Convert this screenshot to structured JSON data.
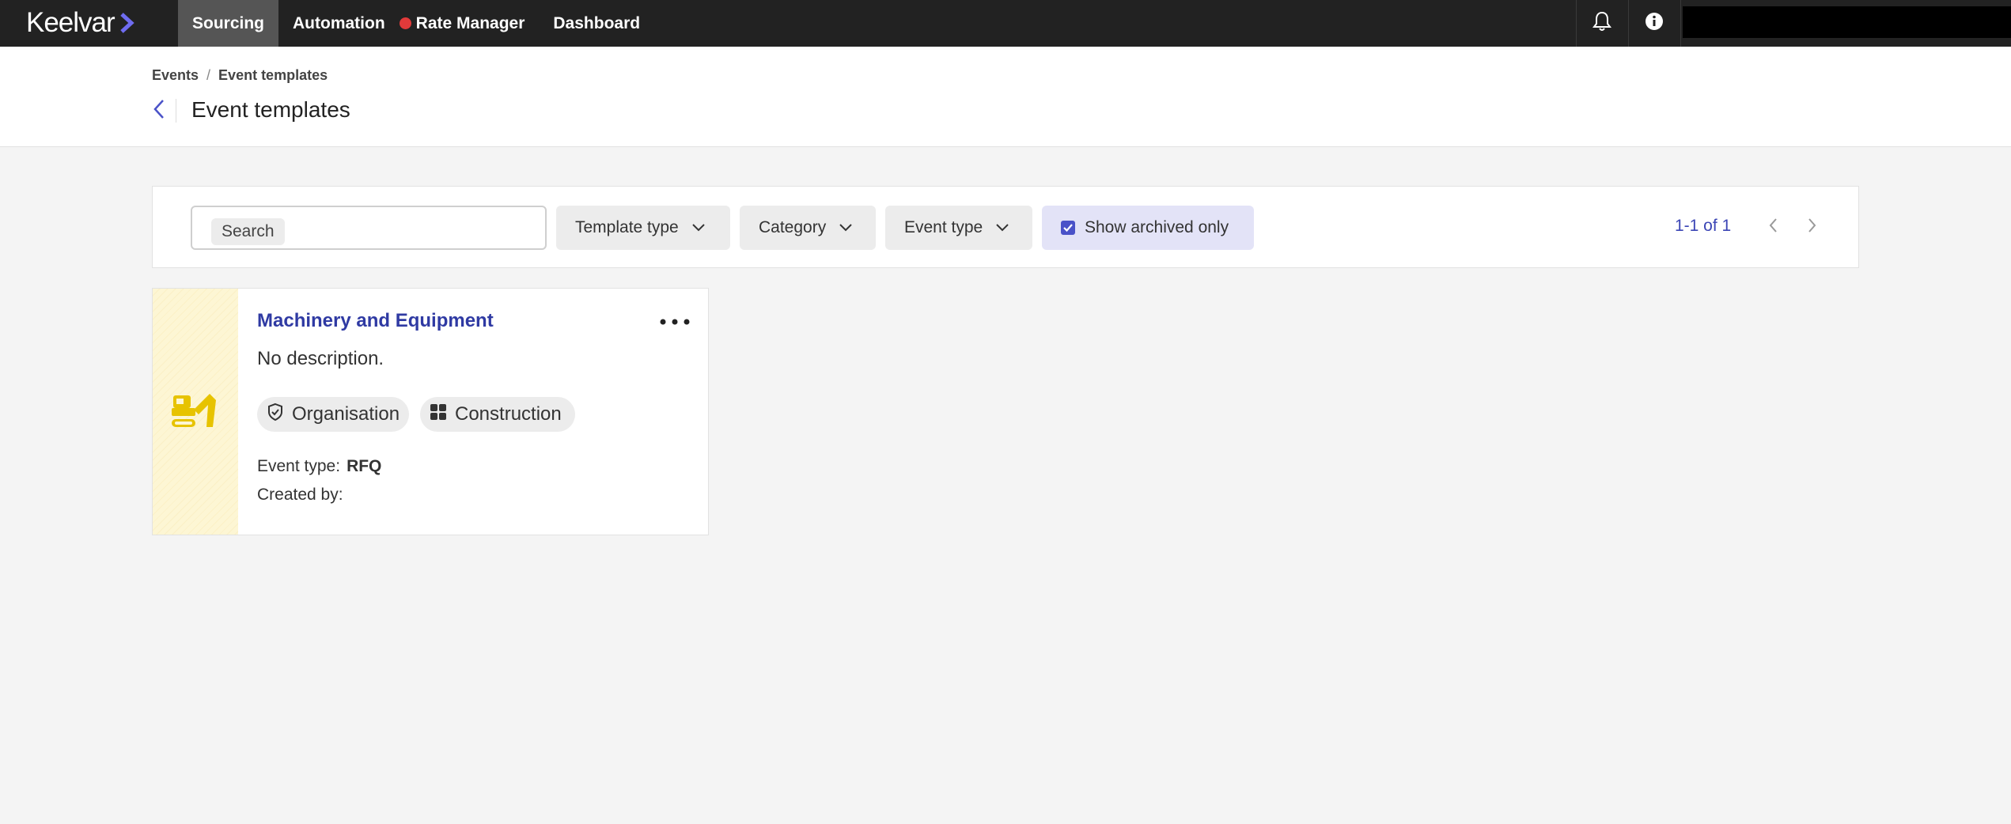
{
  "app": {
    "brand": "Keelvar",
    "accent": "#5c60e0"
  },
  "nav": {
    "items": [
      {
        "label": "Sourcing",
        "active": true
      },
      {
        "label": "Automation",
        "active": false
      },
      {
        "label": "Rate Manager",
        "active": false,
        "status_color": "#e23a3a"
      },
      {
        "label": "Dashboard",
        "active": false
      }
    ],
    "icons": [
      "bell-icon",
      "info-icon"
    ]
  },
  "header": {
    "breadcrumb": [
      "Events",
      "Event templates"
    ],
    "breadcrumb_sep": "/",
    "title": "Event templates"
  },
  "filters": {
    "search_chip": "Search",
    "template_type": "Template type",
    "category": "Category",
    "event_type": "Event type",
    "show_archived": {
      "label": "Show archived only",
      "checked": true
    },
    "pager": "1-1 of 1"
  },
  "templates": [
    {
      "title": "Machinery and Equipment",
      "description": "No description.",
      "tags": [
        {
          "label": "Organisation",
          "icon": "shield-check-icon"
        },
        {
          "label": "Construction",
          "icon": "grid-icon"
        }
      ],
      "event_type_label": "Event type:",
      "event_type_value": "RFQ",
      "created_by_label": "Created by:",
      "created_by_value": "",
      "icon": "excavator-icon",
      "icon_color": "#e7c300"
    }
  ]
}
